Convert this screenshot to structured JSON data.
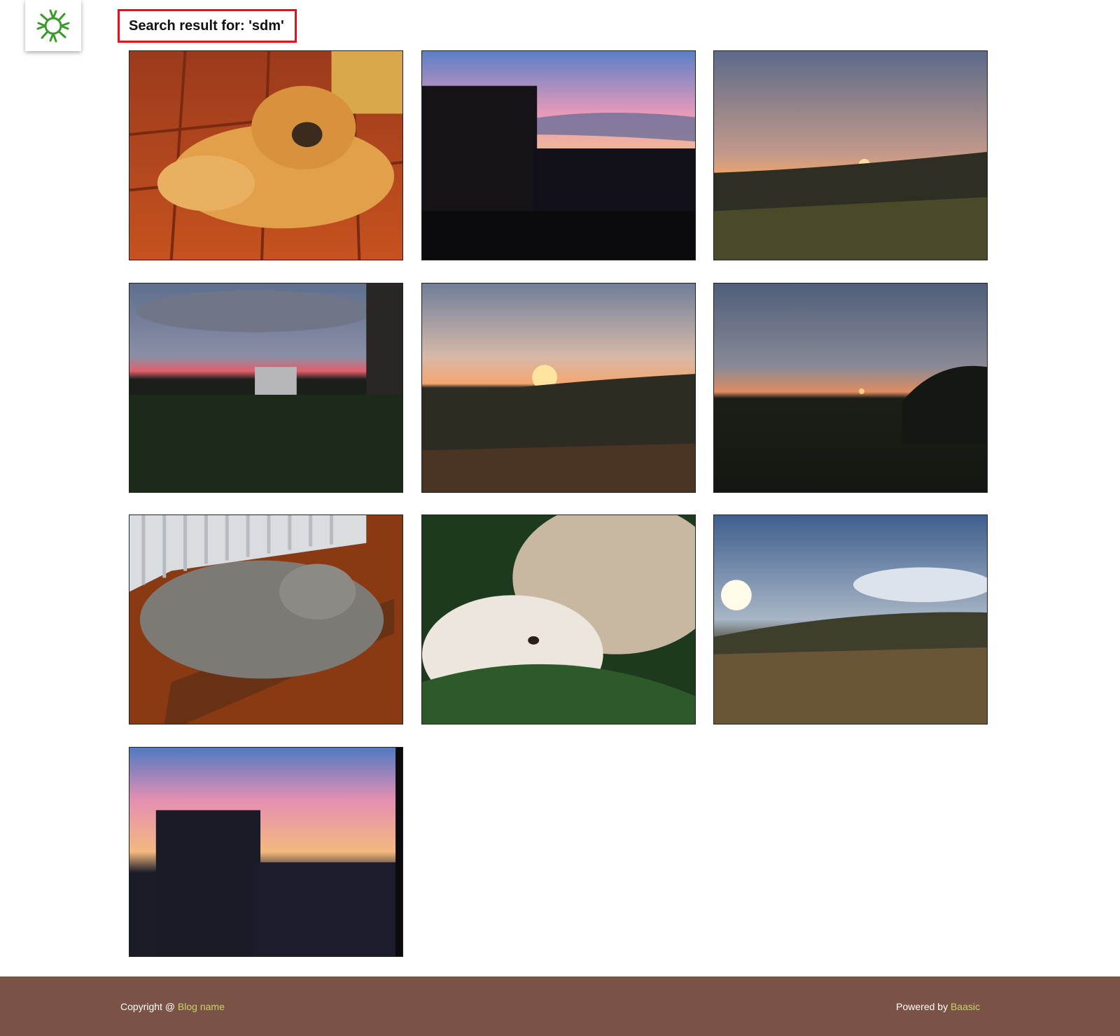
{
  "header": {
    "logo_icon": "sunburst-logo-icon",
    "search_title": "Search result for: 'sdm'"
  },
  "results": [
    {
      "subject": "dog"
    },
    {
      "subject": "city-sunset"
    },
    {
      "subject": "field-sunset"
    },
    {
      "subject": "city-sunset-clouds"
    },
    {
      "subject": "field-sunset"
    },
    {
      "subject": "field-sunset"
    },
    {
      "subject": "cat"
    },
    {
      "subject": "cat-and-dog"
    },
    {
      "subject": "field-sun"
    },
    {
      "subject": "city-sunset"
    }
  ],
  "footer": {
    "copyright_prefix": "Copyright @ ",
    "blog_name": "Blog name",
    "powered_prefix": "Powered by ",
    "powered_link": "Baasic"
  },
  "colors": {
    "accent_link": "#c6d36a",
    "footer_bg": "#7b5346",
    "highlight_border": "#e0141e"
  }
}
